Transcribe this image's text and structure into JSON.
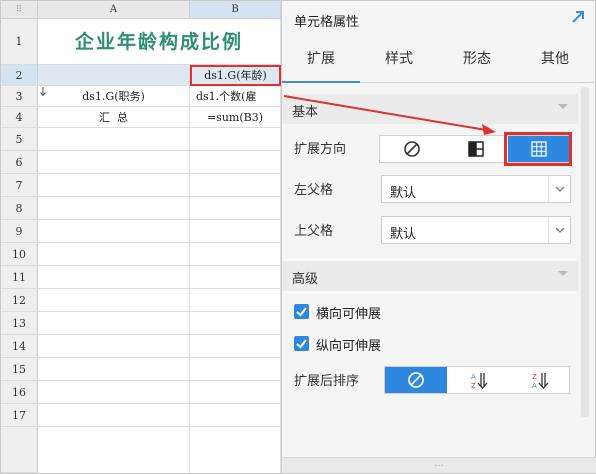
{
  "sheet": {
    "corner_glyph": "⠿",
    "columns": [
      "A",
      "B"
    ],
    "rows": [
      "1",
      "2",
      "3",
      "4",
      "5",
      "6",
      "7",
      "8",
      "9",
      "10",
      "11",
      "12",
      "13",
      "14",
      "15",
      "16",
      "17"
    ],
    "title": "企业年龄构成比例",
    "b2": "ds1.G(年龄)",
    "a3": "ds1.G(职务)",
    "b3": "ds1.个数(雇",
    "a4": "汇  总",
    "b4": "=sum(B3)"
  },
  "panel": {
    "title": "单元格属性",
    "tabs": [
      "扩展",
      "样式",
      "形态",
      "其他"
    ],
    "active_tab": "扩展",
    "section_basic": "基本",
    "expand_direction_label": "扩展方向",
    "left_parent_label": "左父格",
    "left_parent_value": "默认",
    "top_parent_label": "上父格",
    "top_parent_value": "默认",
    "section_advanced": "高级",
    "h_extend_label": "横向可伸展",
    "v_extend_label": "纵向可伸展",
    "sort_label": "扩展后排序",
    "bottom_handle": "..."
  },
  "colors": {
    "accent": "#2f88e0",
    "highlight": "#e03030",
    "title_green": "#2f8f75"
  }
}
